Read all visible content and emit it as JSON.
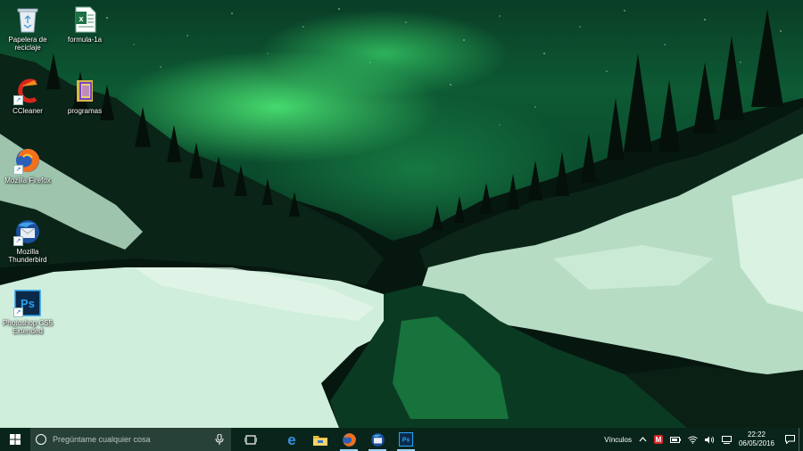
{
  "desktop": {
    "icons": [
      {
        "name": "recycle-bin",
        "label": "Papelera de\nreciclaje",
        "icon": "recycle-bin-icon"
      },
      {
        "name": "formula-1a",
        "label": "formula-1a",
        "icon": "excel-file-icon"
      },
      {
        "name": "ccleaner",
        "label": "CCleaner",
        "icon": "ccleaner-icon"
      },
      {
        "name": "programas",
        "label": "programas",
        "icon": "folder-icon"
      },
      {
        "name": "mozilla-firefox",
        "label": "Mozilla Firefox",
        "icon": "firefox-icon"
      },
      {
        "name": "mozilla-thunderbird",
        "label": "Mozilla\nThunderbird",
        "icon": "thunderbird-icon"
      },
      {
        "name": "photoshop",
        "label": "Photoshop CS5\nExtended",
        "icon": "photoshop-icon",
        "glyph": "Ps"
      }
    ]
  },
  "taskbar": {
    "search_placeholder": "Pregúntame cualquier cosa",
    "pinned": [
      {
        "name": "task-view",
        "icon": "task-view-icon"
      },
      {
        "name": "edge",
        "icon": "edge-icon",
        "glyph": "e"
      },
      {
        "name": "file-explorer",
        "icon": "folder-icon"
      },
      {
        "name": "firefox",
        "icon": "firefox-icon",
        "active": true
      },
      {
        "name": "thunderbird",
        "icon": "thunderbird-icon",
        "active": true
      },
      {
        "name": "photoshop",
        "icon": "photoshop-icon",
        "glyph": "Ps",
        "active": true
      }
    ],
    "tray": {
      "links_label": "Vínculos",
      "time": "22:22",
      "date": "06/05/2016"
    }
  },
  "colors": {
    "aurora": "#3cdc78",
    "taskbar": "#0a261c",
    "active_indicator": "#9fd4ff"
  }
}
